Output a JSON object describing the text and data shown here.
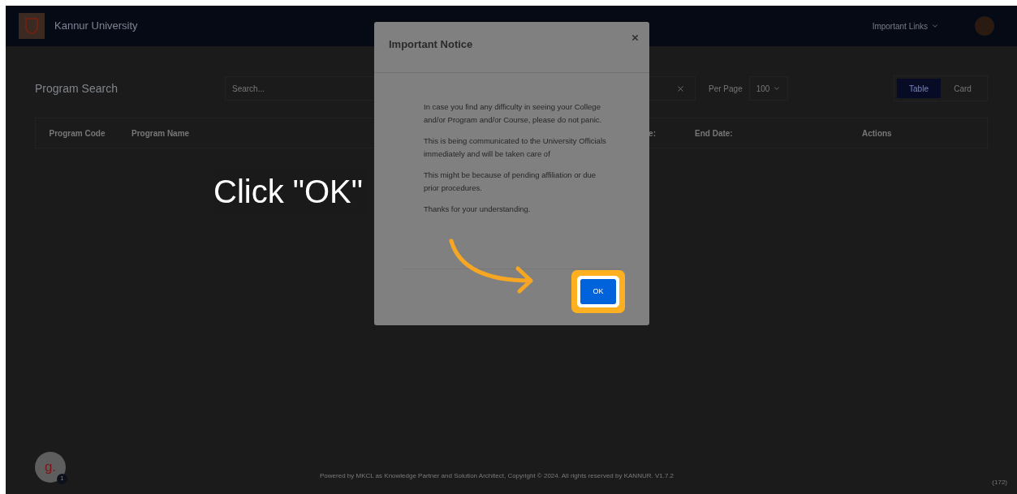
{
  "header": {
    "title": "Kannur University",
    "links_menu": "Important Links"
  },
  "toolbar": {
    "title": "Program Search",
    "search": {
      "placeholder": "Search..."
    },
    "per_page_label": "Per Page",
    "per_page_value": "100",
    "view_tabs": [
      {
        "label": "Table",
        "selected": true
      },
      {
        "label": "Card",
        "selected": false
      }
    ]
  },
  "table": {
    "columns": [
      "Program Code",
      "Program Name",
      "",
      ""
    ],
    "columns_right": [
      "End Date:",
      "Actions"
    ],
    "partial_column": "e:"
  },
  "modal": {
    "title": "Important Notice",
    "paragraphs": [
      "In case you find any difficulty in seeing your College and/or Program and/or Course, please do not panic.",
      "This is being communicated to the University Officials immediately and will be taken care of",
      "This might be because of pending affiliation or due prior procedures.",
      "Thanks for your understanding."
    ],
    "ok_button": "OK"
  },
  "callout": "Click \"OK\"",
  "assistant": {
    "letter": "g.",
    "badge": "1"
  },
  "footer": {
    "text": "Powered by MKCL as Knowledge Partner and Solution Architect, Copyright © 2024. All rights reserved by KANNUR. V1.7.2",
    "corner": "(172)"
  }
}
